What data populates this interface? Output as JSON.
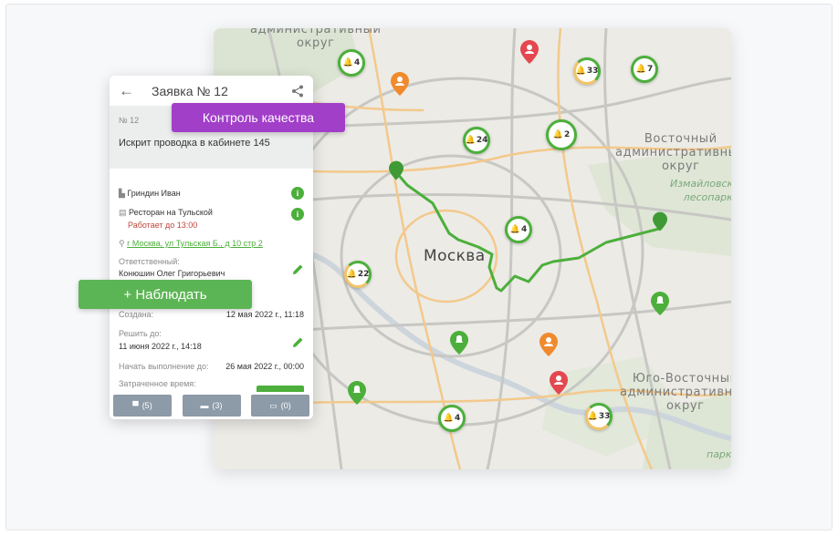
{
  "map": {
    "labels": {
      "north_okrug": "административный\nокруг",
      "east_okrug": "Восточный\nадминистративный\nокруг",
      "southeast_okrug": "Юго-Восточный\nадминистративный\nокруг",
      "park1": "Измайловский\nлесопарк",
      "park2": "парк",
      "city": "Москва"
    },
    "clusters": [
      {
        "count": "4"
      },
      {
        "count": "33"
      },
      {
        "count": "7"
      },
      {
        "count": "24"
      },
      {
        "count": "2"
      },
      {
        "count": "4"
      },
      {
        "count": "22"
      },
      {
        "count": "4"
      },
      {
        "count": "33"
      }
    ]
  },
  "card": {
    "title": "Заявка № 12",
    "number": "№ 12",
    "description": "Искрит проводка в кабинете 145",
    "client": "Гриндин Иван",
    "place": "Ресторан на Тульской",
    "hours": "Работает до 13:00",
    "address": "г Москва, ул Тульская Б., д 10 стр 2",
    "responsible_label": "Ответственный:",
    "responsible_name": "Конюшин Олег Григорьевич",
    "created_label": "Создана:",
    "created_value": "12 мая 2022 г., 11:18",
    "deadline_label": "Решить до:",
    "deadline_value": "11 июня 2022 г., 14:18",
    "start_label": "Начать выполнение до:",
    "start_value": "26 мая 2022 г., 00:00",
    "spent_label": "Затраченное время:",
    "footer": {
      "comments": "(5)",
      "folders": "(3)",
      "payments": "(0)"
    }
  },
  "badges": {
    "quality": "Контроль качества",
    "watch": "+ Наблюдать"
  },
  "colors": {
    "green": "#4caf3b",
    "purple": "#a23fc9",
    "orange": "#f08a2c",
    "red": "#e4474f"
  }
}
